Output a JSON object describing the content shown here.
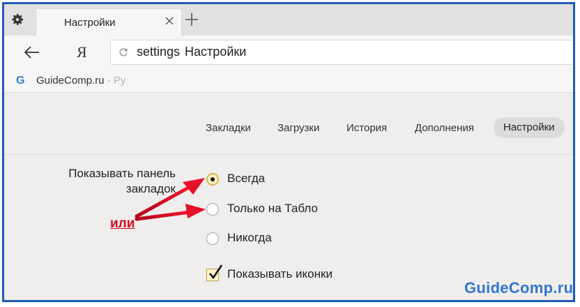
{
  "tab": {
    "title": "Настройки"
  },
  "address_bar": {
    "logo": "Я",
    "url_prefix": "settings",
    "url_title": "Настройки"
  },
  "bookmarks_bar": {
    "item_label": "GuideComp.ru",
    "item_suffix": " - Ру",
    "item_icon": "G"
  },
  "settings_nav": {
    "items": [
      {
        "label": "Закладки"
      },
      {
        "label": "Загрузки"
      },
      {
        "label": "История"
      },
      {
        "label": "Дополнения"
      },
      {
        "label": "Настройки",
        "active": true
      }
    ]
  },
  "bookmarks_setting": {
    "label_line1": "Показывать панель",
    "label_line2": "закладок",
    "options": [
      {
        "label": "Всегда",
        "checked": true
      },
      {
        "label": "Только на Табло",
        "checked": false
      },
      {
        "label": "Никогда",
        "checked": false
      }
    ],
    "show_icons": {
      "label": "Показывать иконки",
      "checked": true
    }
  },
  "annotation": {
    "text": "или",
    "color": "#d8091f"
  },
  "watermark": {
    "text": "GuideComp.ru",
    "color": "#3276d1"
  },
  "colors": {
    "frame": "#1e5bb5",
    "page_bg": "#f0eeec",
    "active_nav_bg": "#dedcda"
  }
}
